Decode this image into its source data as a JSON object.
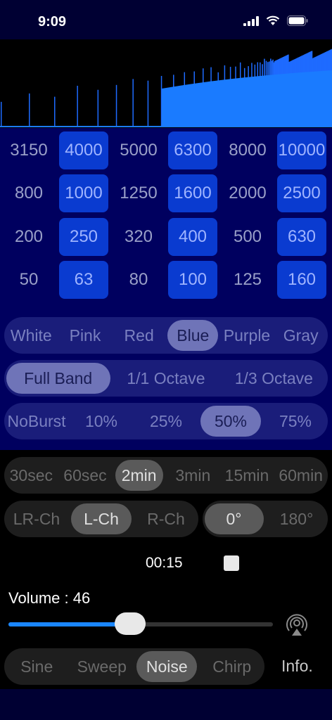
{
  "status": {
    "time": "9:09"
  },
  "frequencies": {
    "rows": [
      [
        {
          "label": "3150",
          "on": false
        },
        {
          "label": "4000",
          "on": true
        },
        {
          "label": "5000",
          "on": false
        },
        {
          "label": "6300",
          "on": true
        },
        {
          "label": "8000",
          "on": false
        },
        {
          "label": "10000",
          "on": true
        }
      ],
      [
        {
          "label": "800",
          "on": false
        },
        {
          "label": "1000",
          "on": true
        },
        {
          "label": "1250",
          "on": false
        },
        {
          "label": "1600",
          "on": true
        },
        {
          "label": "2000",
          "on": false
        },
        {
          "label": "2500",
          "on": true
        }
      ],
      [
        {
          "label": "200",
          "on": false
        },
        {
          "label": "250",
          "on": true
        },
        {
          "label": "320",
          "on": false
        },
        {
          "label": "400",
          "on": true
        },
        {
          "label": "500",
          "on": false
        },
        {
          "label": "630",
          "on": true
        }
      ],
      [
        {
          "label": "50",
          "on": false
        },
        {
          "label": "63",
          "on": true
        },
        {
          "label": "80",
          "on": false
        },
        {
          "label": "100",
          "on": true
        },
        {
          "label": "125",
          "on": false
        },
        {
          "label": "160",
          "on": true
        }
      ]
    ]
  },
  "noise_color": {
    "options": [
      "White",
      "Pink",
      "Red",
      "Blue",
      "Purple",
      "Gray"
    ],
    "selected": "Blue"
  },
  "band": {
    "options": [
      "Full Band",
      "1/1 Octave",
      "1/3 Octave"
    ],
    "selected": "Full Band"
  },
  "burst": {
    "options": [
      "NoBurst",
      "10%",
      "25%",
      "50%",
      "75%"
    ],
    "selected": "50%"
  },
  "duration": {
    "options": [
      "30sec",
      "60sec",
      "2min",
      "3min",
      "15min",
      "60min"
    ],
    "selected": "2min"
  },
  "channel": {
    "options": [
      "LR-Ch",
      "L-Ch",
      "R-Ch"
    ],
    "selected": "L-Ch"
  },
  "phase": {
    "options": [
      "0°",
      "180°"
    ],
    "selected": "0°"
  },
  "playback": {
    "elapsed": "00:15"
  },
  "volume": {
    "label": "Volume : 46",
    "value": 46,
    "max": 100
  },
  "mode": {
    "options": [
      "Sine",
      "Sweep",
      "Noise",
      "Chirp"
    ],
    "selected": "Noise"
  },
  "info_label": "Info.",
  "colors": {
    "accent": "#1a86ff",
    "panel": "#00005f",
    "active_cell": "#0a3bd0"
  }
}
